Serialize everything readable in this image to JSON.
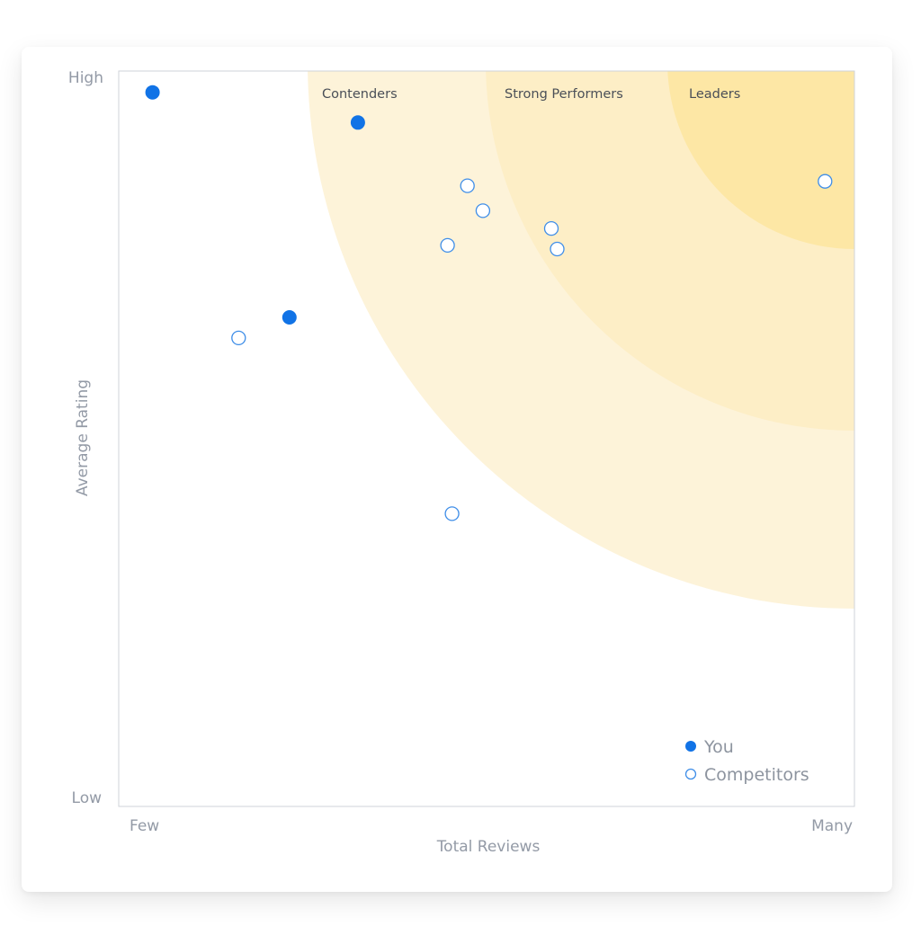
{
  "chart_data": {
    "type": "scatter",
    "xlabel": "Total Reviews",
    "ylabel": "Average Rating",
    "x_tick_labels": [
      "Few",
      "Many"
    ],
    "y_tick_labels": [
      "Low",
      "High"
    ],
    "xlim": [
      0,
      100
    ],
    "ylim": [
      0,
      100
    ],
    "grid": false,
    "legend_position": "bottom-right",
    "regions": [
      {
        "label": "Contenders",
        "color": "#fdf3d9"
      },
      {
        "label": "Strong Performers",
        "color": "#fdeec6"
      },
      {
        "label": "Leaders",
        "color": "#fde7a5"
      }
    ],
    "series": [
      {
        "name": "You",
        "marker": "filled",
        "color": "#1173e6",
        "points": [
          [
            4.6,
            97.1
          ],
          [
            32.5,
            93.0
          ],
          [
            23.2,
            66.5
          ]
        ]
      },
      {
        "name": "Competitors",
        "marker": "hollow",
        "color": "#3f8ee8",
        "points": [
          [
            47.4,
            84.4
          ],
          [
            49.5,
            81.0
          ],
          [
            44.7,
            76.3
          ],
          [
            58.8,
            78.6
          ],
          [
            59.6,
            75.8
          ],
          [
            16.3,
            63.7
          ],
          [
            45.3,
            39.8
          ],
          [
            96.0,
            85.0
          ]
        ]
      }
    ]
  }
}
